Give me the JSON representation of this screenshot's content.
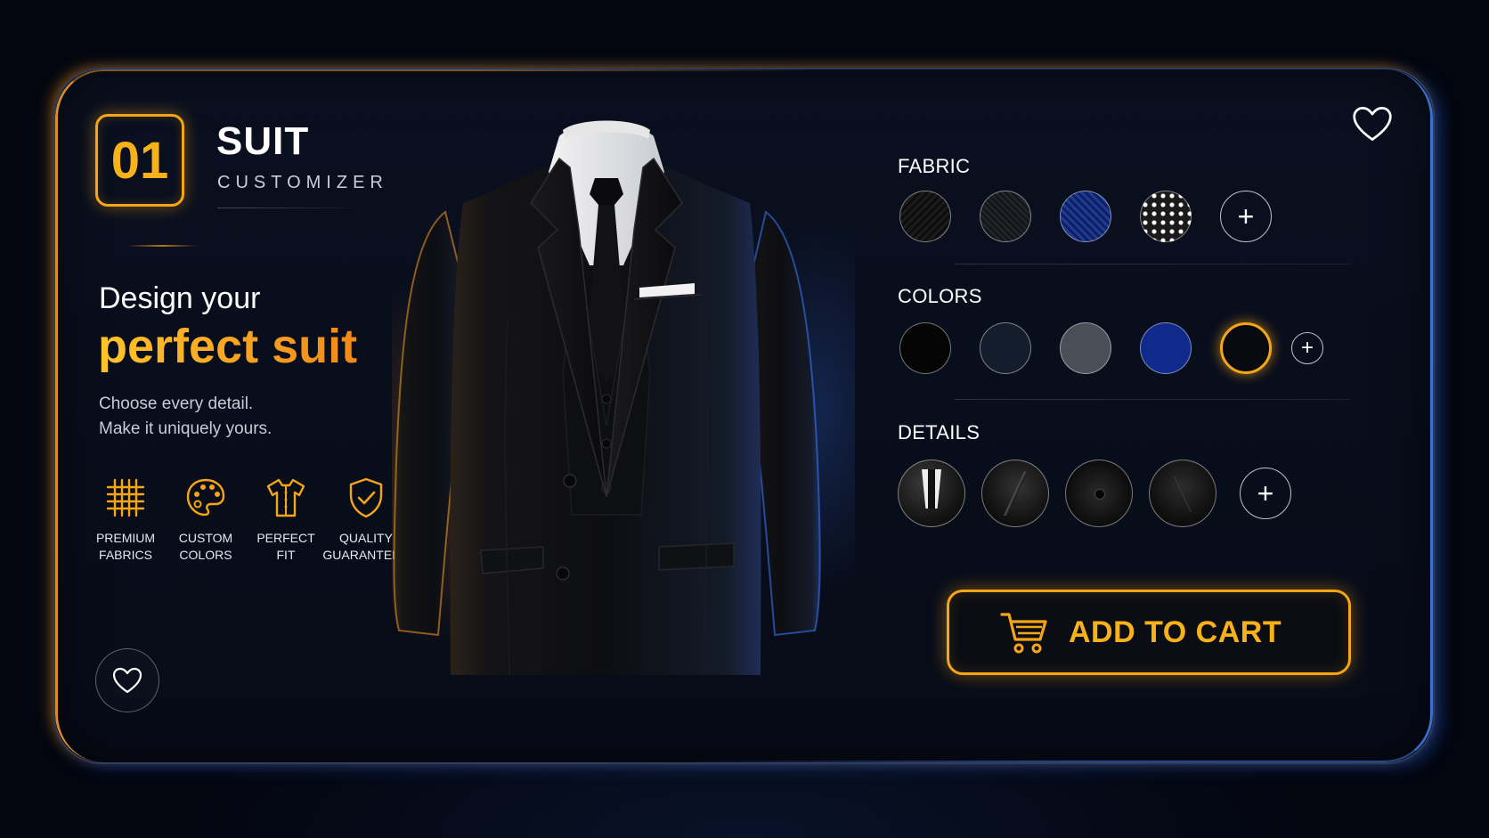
{
  "step": {
    "number": "01"
  },
  "brand": {
    "title": "SUIT",
    "subtitle": "CUSTOMIZER"
  },
  "hero": {
    "line1": "Design your",
    "line2": "perfect suit",
    "tagline_1": "Choose every detail.",
    "tagline_2": "Make it uniquely yours."
  },
  "features": [
    {
      "label": "PREMIUM\nFABRICS",
      "icon": "grid-fabric-icon"
    },
    {
      "label": "CUSTOM\nCOLORS",
      "icon": "palette-icon"
    },
    {
      "label": "PERFECT\nFIT",
      "icon": "shirt-icon"
    },
    {
      "label": "QUALITY\nGUARANTEED",
      "icon": "shield-check-icon"
    }
  ],
  "sections": {
    "fabric": {
      "label": "FABRIC"
    },
    "colors": {
      "label": "COLORS"
    },
    "details": {
      "label": "DETAILS"
    }
  },
  "colors": {
    "accent": "#f5a516",
    "swatches": [
      "#050505",
      "#141d2c",
      "#4a4e57",
      "#0f2a8a",
      "#07090f"
    ],
    "selected_index": 4
  },
  "add_symbol": "+",
  "cart": {
    "label": "ADD TO CART"
  }
}
